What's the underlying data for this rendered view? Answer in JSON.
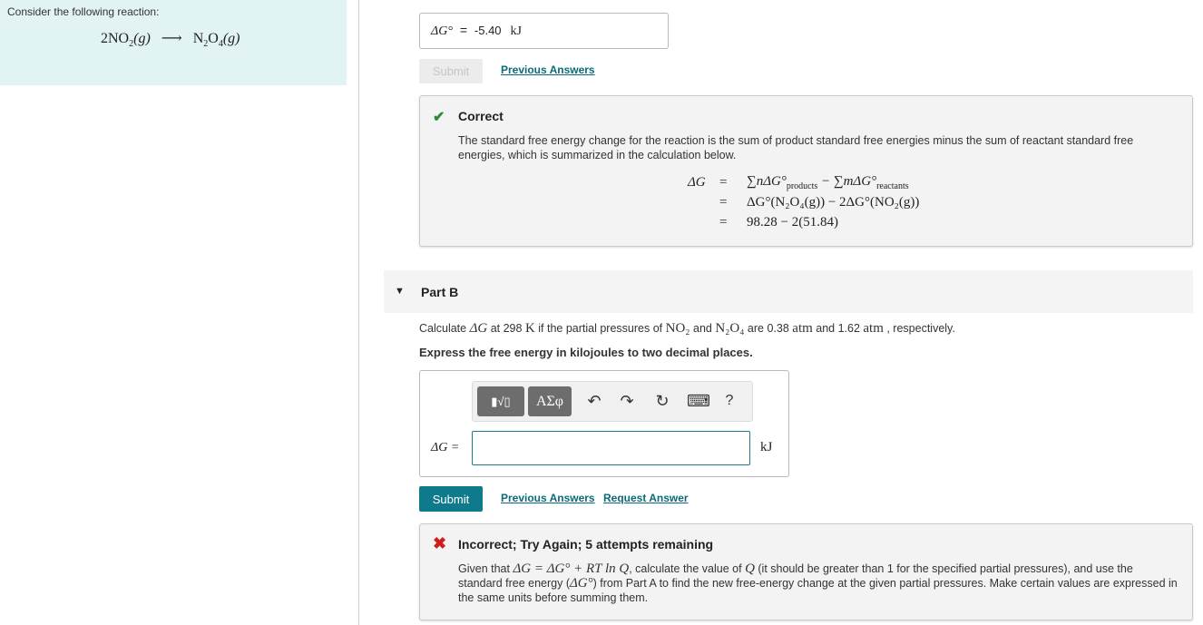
{
  "left": {
    "intro": "Consider the following reaction:",
    "reactant": "2NO",
    "reactant_sub": "2",
    "reactant_phase": "(g)",
    "product": "N",
    "product_sub1": "2",
    "product_mid": "O",
    "product_sub2": "4",
    "product_phase": "(g)"
  },
  "part_a": {
    "answer_label": "ΔG°",
    "answer_eq": "=",
    "answer_value": "-5.40",
    "answer_unit": "kJ",
    "submit_label": "Submit",
    "previous_answers": "Previous Answers",
    "feedback": {
      "title": "Correct",
      "body": "The standard free energy change for the reaction is the sum of product standard free energies minus the sum of reactant standard free energies, which is summarized in the calculation below.",
      "eq_lhs": "ΔG",
      "eq_sign": "=",
      "row1_a": "∑nΔG°",
      "row1_a_sub": "products",
      "row1_mid": " − ∑mΔG°",
      "row1_b_sub": "reactants",
      "row2": "ΔG°(N₂O₄(g)) − 2ΔG°(NO₂(g))",
      "row3": "98.28 − 2(51.84)"
    }
  },
  "part_b": {
    "title": "Part B",
    "q_pre": "Calculate ",
    "q_dg": "ΔG",
    "q_at": " at 298 ",
    "q_k": "K",
    "q_if": " if the partial pressures of ",
    "q_no2": "NO₂",
    "q_and": " and ",
    "q_n2o4": "N₂O₄",
    "q_are": " are 0.38 ",
    "q_atm1": "atm",
    "q_and2": " and 1.62 ",
    "q_atm2": "atm",
    "q_end": " , respectively.",
    "instruction": "Express the free energy in kilojoules to two decimal places.",
    "toolbar": {
      "templates_label": "▮√▯",
      "symbols_label": "ΑΣφ",
      "undo": "↶",
      "redo": "↷",
      "reset": "↻",
      "keyboard": "⌨",
      "help": "?"
    },
    "answer_label": "ΔG =",
    "answer_placeholder": "",
    "answer_unit": "kJ",
    "submit_label": "Submit",
    "previous_answers": "Previous Answers",
    "request_answer": "Request Answer",
    "feedback": {
      "title": "Incorrect; Try Again; 5 attempts remaining",
      "body_1": "Given that ",
      "body_eq": "ΔG = ΔG° + RT ln Q",
      "body_2": ", calculate the value of ",
      "body_q": "Q",
      "body_3": " (it should be greater than 1 for the specified partial pressures), and use the standard free energy (",
      "body_dg": "ΔG°",
      "body_4": ") from Part A to find the new free-energy change at the given partial pressures. Make certain values are expressed in the same units before summing them."
    }
  },
  "colors": {
    "accent": "#0f7a8c",
    "link": "#0a6a7a",
    "correct": "#2e8b3a",
    "incorrect": "#cc1f1f",
    "left_panel_bg": "#e2f3f4"
  }
}
